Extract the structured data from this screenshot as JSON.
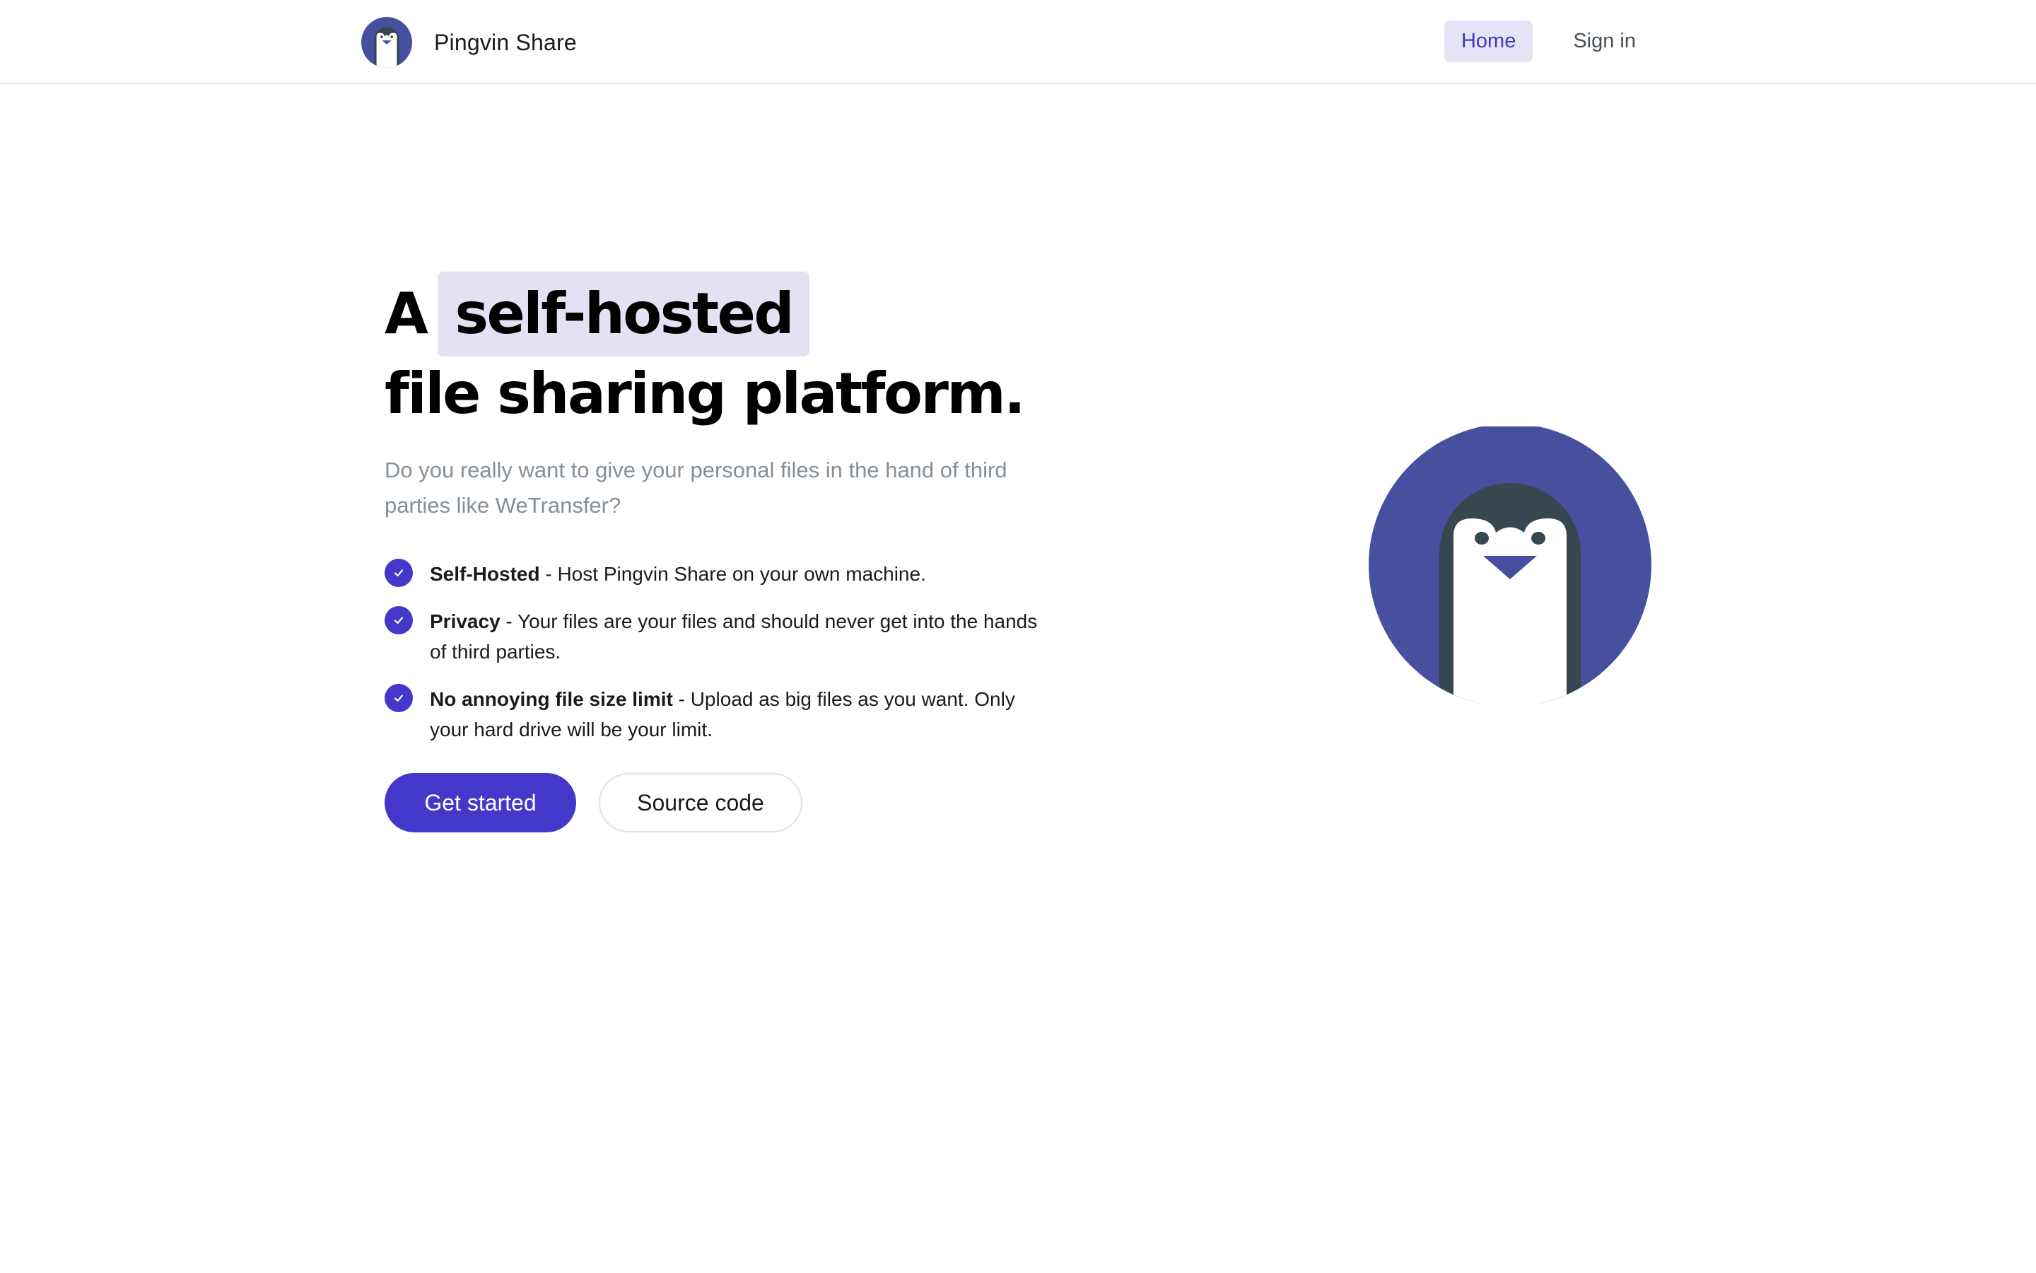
{
  "app": {
    "name": "Pingvin Share",
    "logo_icon": "penguin-logo-icon"
  },
  "nav": {
    "items": [
      {
        "label": "Home",
        "active": true
      },
      {
        "label": "Sign in",
        "active": false
      }
    ]
  },
  "hero": {
    "headline_prefix": "A",
    "headline_highlight": "self-hosted",
    "headline_line2": "file sharing platform.",
    "lead": "Do you really want to give your personal files in the hand of third parties like WeTransfer?",
    "features": [
      {
        "title": "Self-Hosted",
        "text": " - Host Pingvin Share on your own machine."
      },
      {
        "title": "Privacy",
        "text": " - Your files are your files and should never get into the hands of third parties."
      },
      {
        "title": "No annoying file size limit",
        "text": " - Upload as big files as you want. Only your hard drive will be your limit."
      }
    ],
    "buttons": {
      "primary": "Get started",
      "secondary": "Source code"
    },
    "illustration_icon": "penguin-illustration-icon"
  },
  "colors": {
    "accent": "#4338ca",
    "logo_circle": "#46509e",
    "penguin_body": "#364750",
    "highlight_bg": "#e3e2f3",
    "nav_active_bg": "#e5e4f4"
  }
}
